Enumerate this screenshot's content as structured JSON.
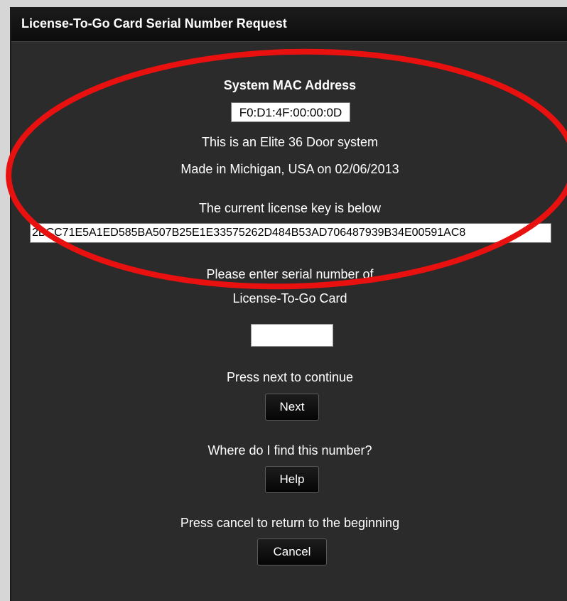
{
  "window": {
    "title": "License-To-Go Card Serial Number Request"
  },
  "system": {
    "mac_heading": "System MAC Address",
    "mac_value": "F0:D1:4F:00:00:0D",
    "system_type": "This is an Elite 36 Door system",
    "made_in": "Made in Michigan, USA on 02/06/2013"
  },
  "license": {
    "heading": "The current license key is below",
    "key": "2BCC71E5A1ED585BA507B25E1E33575262D484B53AD706487939B34E00591AC8"
  },
  "serial": {
    "prompt_line1": "Please enter serial number of",
    "prompt_line2": "License-To-Go Card",
    "value": ""
  },
  "actions": {
    "next_prompt": "Press next to continue",
    "next_label": "Next",
    "help_prompt": "Where do I find this number?",
    "help_label": "Help",
    "cancel_prompt": "Press cancel to return to the beginning",
    "cancel_label": "Cancel"
  },
  "annotation": {
    "ellipse_color": "#e8110f"
  }
}
